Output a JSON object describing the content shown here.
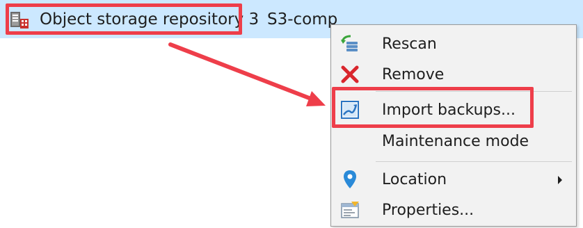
{
  "row": {
    "name": "Object storage repository 3",
    "type": "S3-comp",
    "icon": "object-storage-repository-icon"
  },
  "menu": {
    "items": [
      {
        "label": "Rescan",
        "icon": "rescan-icon"
      },
      {
        "label": "Remove",
        "icon": "remove-icon"
      },
      {
        "label": "Import backups...",
        "icon": "import-backups-icon"
      },
      {
        "label": "Maintenance mode",
        "icon": ""
      },
      {
        "label": "Location",
        "icon": "location-pin-icon",
        "has_submenu": true
      },
      {
        "label": "Properties...",
        "icon": "properties-icon"
      }
    ]
  },
  "colors": {
    "selection_row": "#cce8ff",
    "menu_background": "#f2f2f2",
    "annotation": "#ee3e4a",
    "remove_red": "#d9262d",
    "location_blue": "#2a8ad8"
  }
}
